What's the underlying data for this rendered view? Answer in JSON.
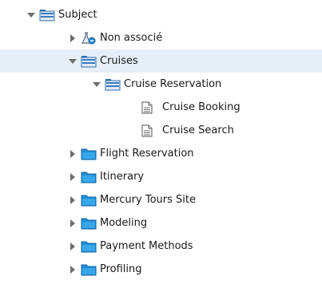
{
  "tree": {
    "items": [
      {
        "label": "Subject",
        "icon": "folder-open-icon",
        "expanded": true,
        "level": 0
      },
      {
        "label": "Non associé",
        "icon": "flask-link-icon",
        "expanded": false,
        "level": 1
      },
      {
        "label": "Cruises",
        "icon": "folder-open-icon",
        "expanded": true,
        "level": 1,
        "selected": true
      },
      {
        "label": "Cruise Reservation",
        "icon": "folder-open-icon",
        "expanded": true,
        "level": 2
      },
      {
        "label": "Cruise Booking",
        "icon": "document-icon",
        "level": 3
      },
      {
        "label": "Cruise Search",
        "icon": "document-icon",
        "level": 3
      },
      {
        "label": "Flight Reservation",
        "icon": "folder-icon",
        "expanded": false,
        "level": 1
      },
      {
        "label": "Itinerary",
        "icon": "folder-icon",
        "expanded": false,
        "level": 1
      },
      {
        "label": "Mercury Tours Site",
        "icon": "folder-icon",
        "expanded": false,
        "level": 1
      },
      {
        "label": "Modeling",
        "icon": "folder-icon",
        "expanded": false,
        "level": 1
      },
      {
        "label": "Payment Methods",
        "icon": "folder-icon",
        "expanded": false,
        "level": 1
      },
      {
        "label": "Profiling",
        "icon": "folder-icon",
        "expanded": false,
        "level": 1
      }
    ]
  },
  "colors": {
    "selection": "#e6eef8",
    "folder_blue": "#1e8fd6",
    "folder_open_blue": "#3a7bbf"
  }
}
